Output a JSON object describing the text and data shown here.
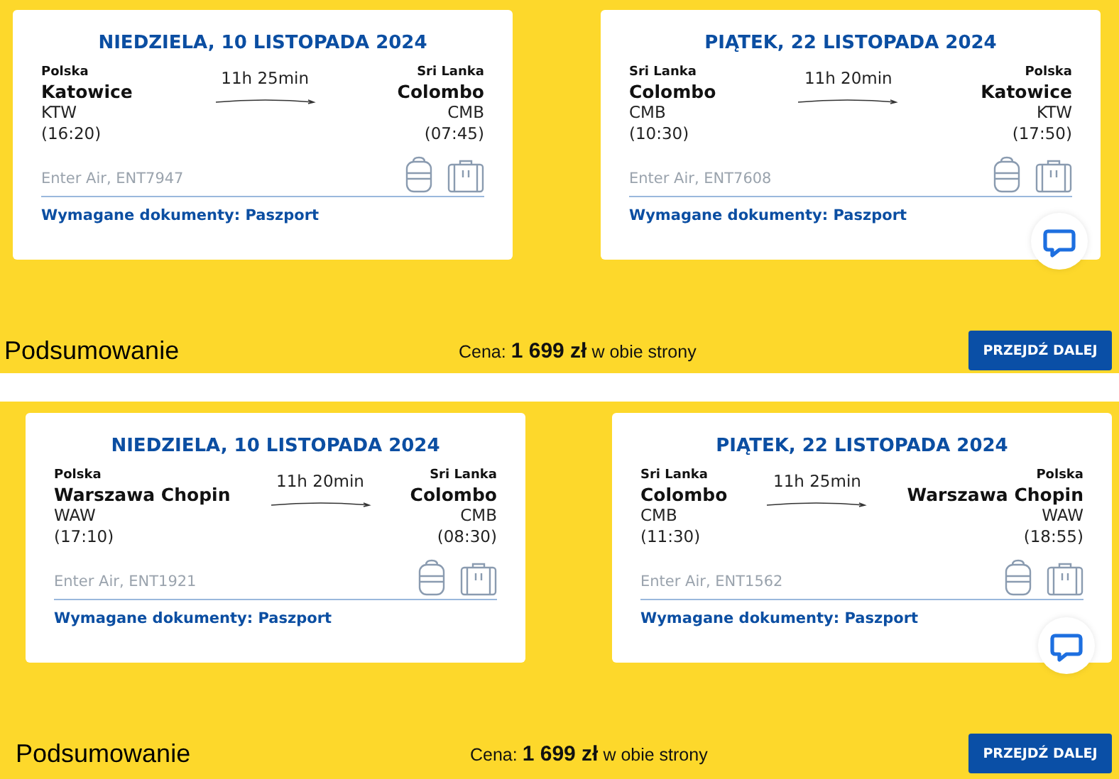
{
  "sections": [
    {
      "legs": [
        {
          "date": "NIEDZIELA, 10 LISTOPADA 2024",
          "from": {
            "country": "Polska",
            "city": "Katowice",
            "code": "KTW",
            "time": "(16:20)"
          },
          "duration": "11h 25min",
          "to": {
            "country": "Sri Lanka",
            "city": "Colombo",
            "code": "CMB",
            "time": "(07:45)"
          },
          "flight": "Enter Air, ENT7947",
          "documents": "Wymagane dokumenty: Paszport"
        },
        {
          "date": "PIĄTEK, 22 LISTOPADA 2024",
          "from": {
            "country": "Sri Lanka",
            "city": "Colombo",
            "code": "CMB",
            "time": "(10:30)"
          },
          "duration": "11h 20min",
          "to": {
            "country": "Polska",
            "city": "Katowice",
            "code": "KTW",
            "time": "(17:50)"
          },
          "flight": "Enter Air, ENT7608",
          "documents": "Wymagane dokumenty: Paszport"
        }
      ],
      "summary": {
        "title": "Podsumowanie",
        "price": "Cena: **1 699 zł** w obie strony",
        "button": "PRZEJDŹ DALEJ"
      }
    },
    {
      "legs": [
        {
          "date": "NIEDZIELA, 10 LISTOPADA 2024",
          "from": {
            "country": "Polska",
            "city": "Warszawa Chopin",
            "code": "WAW",
            "time": "(17:10)"
          },
          "duration": "11h 20min",
          "to": {
            "country": "Sri Lanka",
            "city": "Colombo",
            "code": "CMB",
            "time": "(08:30)"
          },
          "flight": "Enter Air, ENT1921",
          "documents": "Wymagane dokumenty: Paszport"
        },
        {
          "date": "PIĄTEK, 22 LISTOPADA 2024",
          "from": {
            "country": "Sri Lanka",
            "city": "Colombo",
            "code": "CMB",
            "time": "(11:30)"
          },
          "duration": "11h 25min",
          "to": {
            "country": "Polska",
            "city": "Warszawa Chopin",
            "code": "WAW",
            "time": "(18:55)"
          },
          "flight": "Enter Air, ENT1562",
          "documents": "Wymagane dokumenty: Paszport"
        }
      ],
      "summary": {
        "title": "Podsumowanie",
        "price": "Cena: **1 699 zł** w obie strony",
        "button": "PRZEJDŹ DALEJ"
      }
    }
  ]
}
